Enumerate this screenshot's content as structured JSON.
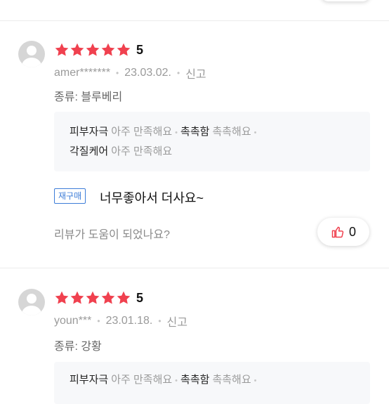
{
  "reviews": [
    {
      "rating": "5",
      "stars": 5,
      "username": "amer*******",
      "date": "23.03.02.",
      "report": "신고",
      "option": "종류: 블루베리",
      "evaluations": [
        {
          "items": [
            {
              "key": "피부자극",
              "value": "아주 만족해요"
            },
            {
              "key": "촉촉함",
              "value": "촉촉해요"
            }
          ]
        },
        {
          "items": [
            {
              "key": "각질케어",
              "value": "아주 만족해요"
            }
          ]
        }
      ],
      "badge": "재구매",
      "content": "너무좋아서 더사요~",
      "helpful_question": "리뷰가 도움이 되었나요?",
      "like_count": "0"
    },
    {
      "rating": "5",
      "stars": 5,
      "username": "youn***",
      "date": "23.01.18.",
      "report": "신고",
      "option": "종류: 강황",
      "evaluations": [
        {
          "items": [
            {
              "key": "피부자극",
              "value": "아주 만족해요"
            },
            {
              "key": "촉촉함",
              "value": "촉촉해요"
            }
          ]
        }
      ]
    }
  ],
  "colors": {
    "star": "#f0414f",
    "thumb": "#f0414f",
    "badge": "#3d7dd8"
  }
}
